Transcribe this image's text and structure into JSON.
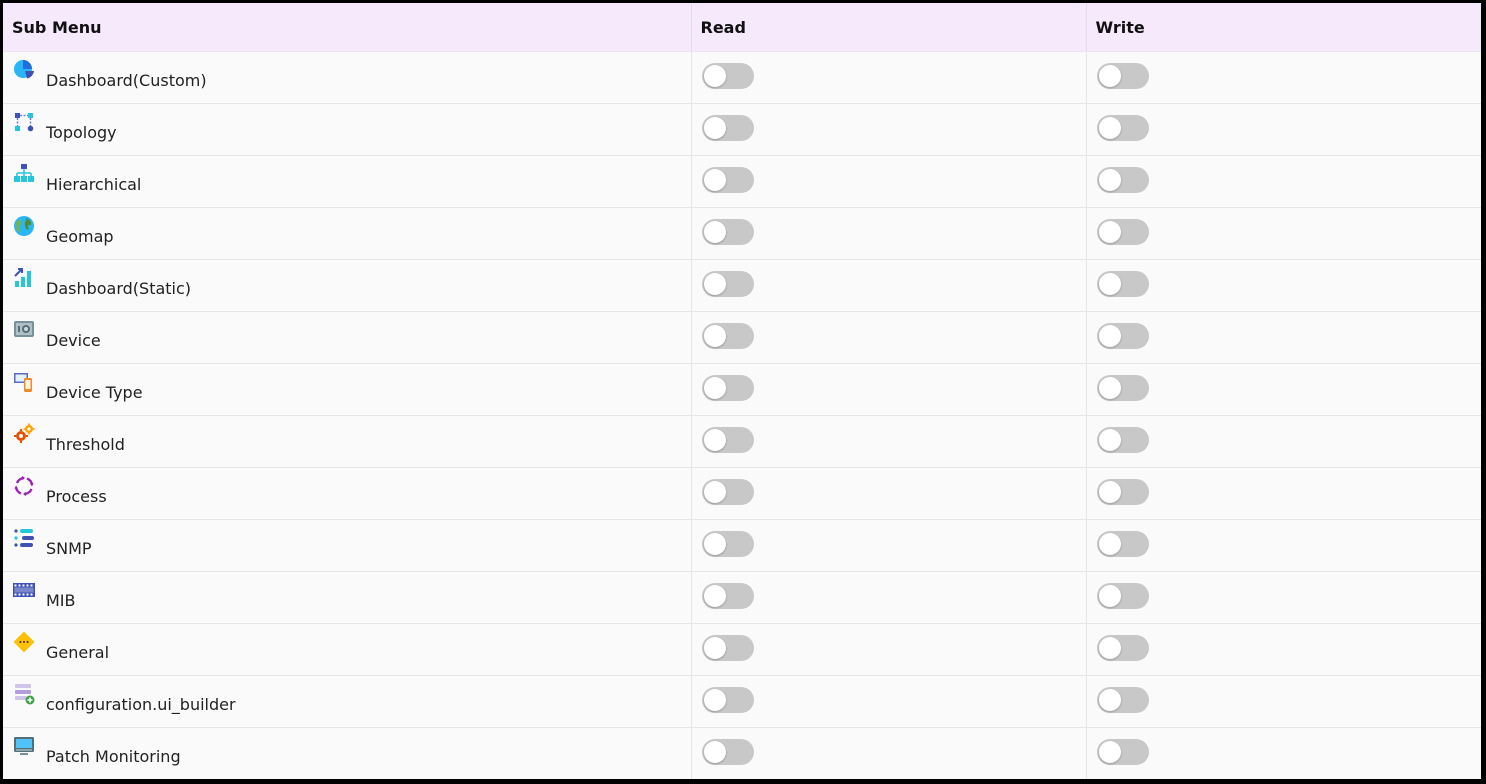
{
  "table": {
    "headers": [
      "Sub Menu",
      "Read",
      "Write"
    ],
    "rows": [
      {
        "label": "Dashboard(Custom)",
        "icon": "pie-chart-icon",
        "read": false,
        "write": false
      },
      {
        "label": "Topology",
        "icon": "topology-icon",
        "read": false,
        "write": false
      },
      {
        "label": "Hierarchical",
        "icon": "hierarchy-icon",
        "read": false,
        "write": false
      },
      {
        "label": "Geomap",
        "icon": "globe-icon",
        "read": false,
        "write": false
      },
      {
        "label": "Dashboard(Static)",
        "icon": "bar-chart-icon",
        "read": false,
        "write": false
      },
      {
        "label": "Device",
        "icon": "safe-icon",
        "read": false,
        "write": false
      },
      {
        "label": "Device Type",
        "icon": "devices-icon",
        "read": false,
        "write": false
      },
      {
        "label": "Threshold",
        "icon": "gears-icon",
        "read": false,
        "write": false
      },
      {
        "label": "Process",
        "icon": "process-cycle-icon",
        "read": false,
        "write": false
      },
      {
        "label": "SNMP",
        "icon": "list-settings-icon",
        "read": false,
        "write": false
      },
      {
        "label": "MIB",
        "icon": "film-strip-icon",
        "read": false,
        "write": false
      },
      {
        "label": "General",
        "icon": "diamond-dots-icon",
        "read": false,
        "write": false
      },
      {
        "label": "configuration.ui_builder",
        "icon": "layers-add-icon",
        "read": false,
        "write": false
      },
      {
        "label": "Patch Monitoring",
        "icon": "monitor-icon",
        "read": false,
        "write": false
      }
    ]
  },
  "colors": {
    "header_bg": "#f6e9fc",
    "toggle_off": "#c8c8c8",
    "row_bg": "#fafafa"
  }
}
